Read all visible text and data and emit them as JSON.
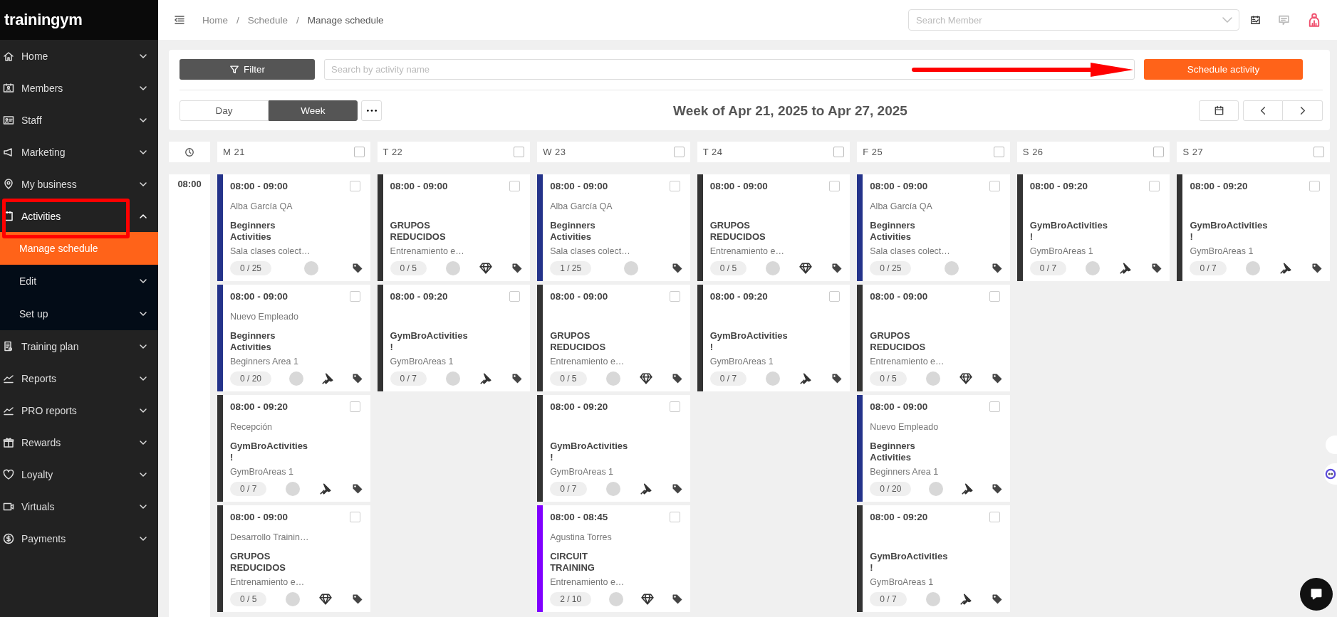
{
  "brand": {
    "logo": "trainingym"
  },
  "sidebar": {
    "items": [
      {
        "label": "Home",
        "expanded": false,
        "highlighted": false
      },
      {
        "label": "Members",
        "expanded": false,
        "highlighted": false
      },
      {
        "label": "Staff",
        "expanded": false,
        "highlighted": false
      },
      {
        "label": "Marketing",
        "expanded": false,
        "highlighted": false
      },
      {
        "label": "My business",
        "expanded": false,
        "highlighted": false
      },
      {
        "label": "Activities",
        "expanded": true,
        "highlighted": true,
        "children": [
          {
            "label": "Manage schedule",
            "selected": true
          },
          {
            "label": "Edit",
            "selected": false
          },
          {
            "label": "Set up",
            "selected": false
          }
        ]
      },
      {
        "label": "Training plan",
        "expanded": false,
        "highlighted": false
      },
      {
        "label": "Reports",
        "expanded": false,
        "highlighted": false
      },
      {
        "label": "PRO reports",
        "expanded": false,
        "highlighted": false
      },
      {
        "label": "Rewards",
        "expanded": false,
        "highlighted": false
      },
      {
        "label": "Loyalty",
        "expanded": false,
        "highlighted": false
      },
      {
        "label": "Virtuals",
        "expanded": false,
        "highlighted": false
      },
      {
        "label": "Payments",
        "expanded": false,
        "highlighted": false
      }
    ]
  },
  "header": {
    "breadcrumbs": [
      {
        "label": "Home",
        "separator": "/"
      },
      {
        "label": "Schedule",
        "separator": "/"
      },
      {
        "label": "Manage schedule"
      }
    ],
    "member_search": {
      "placeholder": "Search Member"
    }
  },
  "toolbar": {
    "filter_button": "Filter",
    "activity_search": {
      "placeholder": "Search by activity name"
    },
    "primary_button": "Schedule activity",
    "callout_arrow": true,
    "views": [
      {
        "label": "Day",
        "selected": false
      },
      {
        "label": "Week",
        "selected": true
      }
    ],
    "title": "Week of Apr 21, 2025 to Apr 27, 2025"
  },
  "schedule": {
    "time_slots": [
      "08:00"
    ],
    "days": [
      {
        "label": "M 21",
        "selected": false,
        "events": [
          {
            "kind": "plain",
            "time": "08:00 - 09:00",
            "instructor": "Alba García QA",
            "activity": "Beginners Activities",
            "location": "Sala clases colect…",
            "capacity": "0 / 25",
            "color": "#24338a",
            "selected": false
          },
          {
            "kind": "pinned",
            "time": "08:00 - 09:00",
            "instructor": "Nuevo Empleado",
            "activity": "Beginners Activities",
            "location": "Beginners Area 1",
            "capacity": "0 / 20",
            "color": "#24338a",
            "selected": false
          },
          {
            "kind": "pinned",
            "time": "08:00 - 09:20",
            "instructor": "Recepción",
            "activity": "GymBroActivities !",
            "location": "GymBroAreas 1",
            "capacity": "0 / 7",
            "color": "#333333",
            "selected": false
          },
          {
            "kind": "premium",
            "time": "08:00 - 09:00",
            "instructor": "Desarrollo Trainin…",
            "activity": "GRUPOS REDUCIDOS",
            "location": "Entrenamiento e…",
            "capacity": "0 / 5",
            "color": "#333333",
            "selected": false
          }
        ]
      },
      {
        "label": "T 22",
        "selected": false,
        "events": [
          {
            "kind": "premium",
            "time": "08:00 - 09:00",
            "activity": "GRUPOS REDUCIDOS",
            "location": "Entrenamiento e…",
            "capacity": "0 / 5",
            "color": "#333333",
            "selected": false
          },
          {
            "kind": "pinned",
            "time": "08:00 - 09:20",
            "activity": "GymBroActivities !",
            "location": "GymBroAreas 1",
            "capacity": "0 / 7",
            "color": "#333333",
            "selected": false
          }
        ]
      },
      {
        "label": "W 23",
        "selected": false,
        "events": [
          {
            "kind": "plain",
            "time": "08:00 - 09:00",
            "instructor": "Alba García QA",
            "activity": "Beginners Activities",
            "location": "Sala clases colect…",
            "capacity": "1 / 25",
            "color": "#24338a",
            "selected": false
          },
          {
            "kind": "premium",
            "time": "08:00 - 09:00",
            "activity": "GRUPOS REDUCIDOS",
            "location": "Entrenamiento e…",
            "capacity": "0 / 5",
            "color": "#333333",
            "selected": false
          },
          {
            "kind": "pinned",
            "time": "08:00 - 09:20",
            "activity": "GymBroActivities !",
            "location": "GymBroAreas 1",
            "capacity": "0 / 7",
            "color": "#333333",
            "selected": false
          },
          {
            "kind": "premium",
            "time": "08:00 - 08:45",
            "instructor": "Agustina Torres",
            "activity": "CIRCUIT TRAINING",
            "location": "Entrenamiento e…",
            "capacity": "2 / 10",
            "color": "#8000ff",
            "selected": false
          }
        ]
      },
      {
        "label": "T 24",
        "selected": false,
        "events": [
          {
            "kind": "premium",
            "time": "08:00 - 09:00",
            "activity": "GRUPOS REDUCIDOS",
            "location": "Entrenamiento e…",
            "capacity": "0 / 5",
            "color": "#333333",
            "selected": false
          },
          {
            "kind": "pinned",
            "time": "08:00 - 09:20",
            "activity": "GymBroActivities !",
            "location": "GymBroAreas 1",
            "capacity": "0 / 7",
            "color": "#333333",
            "selected": false
          }
        ]
      },
      {
        "label": "F 25",
        "selected": false,
        "events": [
          {
            "kind": "plain",
            "time": "08:00 - 09:00",
            "instructor": "Alba García QA",
            "activity": "Beginners Activities",
            "location": "Sala clases colect…",
            "capacity": "0 / 25",
            "color": "#24338a",
            "selected": false
          },
          {
            "kind": "premium",
            "time": "08:00 - 09:00",
            "activity": "GRUPOS REDUCIDOS",
            "location": "Entrenamiento e…",
            "capacity": "0 / 5",
            "color": "#333333",
            "selected": false
          },
          {
            "kind": "pinned",
            "time": "08:00 - 09:00",
            "instructor": "Nuevo Empleado",
            "activity": "Beginners Activities",
            "location": "Beginners Area 1",
            "capacity": "0 / 20",
            "color": "#24338a",
            "selected": false
          },
          {
            "kind": "pinned",
            "time": "08:00 - 09:20",
            "activity": "GymBroActivities !",
            "location": "GymBroAreas 1",
            "capacity": "0 / 7",
            "color": "#333333",
            "selected": false
          }
        ]
      },
      {
        "label": "S 26",
        "selected": false,
        "events": [
          {
            "kind": "pinned",
            "time": "08:00 - 09:20",
            "activity": "GymBroActivities !",
            "location": "GymBroAreas 1",
            "capacity": "0 / 7",
            "color": "#333333",
            "selected": false
          }
        ]
      },
      {
        "label": "S 27",
        "selected": false,
        "events": [
          {
            "kind": "pinned",
            "time": "08:00 - 09:20",
            "activity": "GymBroActivities !",
            "location": "GymBroAreas 1",
            "capacity": "0 / 7",
            "color": "#333333",
            "selected": false
          }
        ]
      }
    ]
  }
}
